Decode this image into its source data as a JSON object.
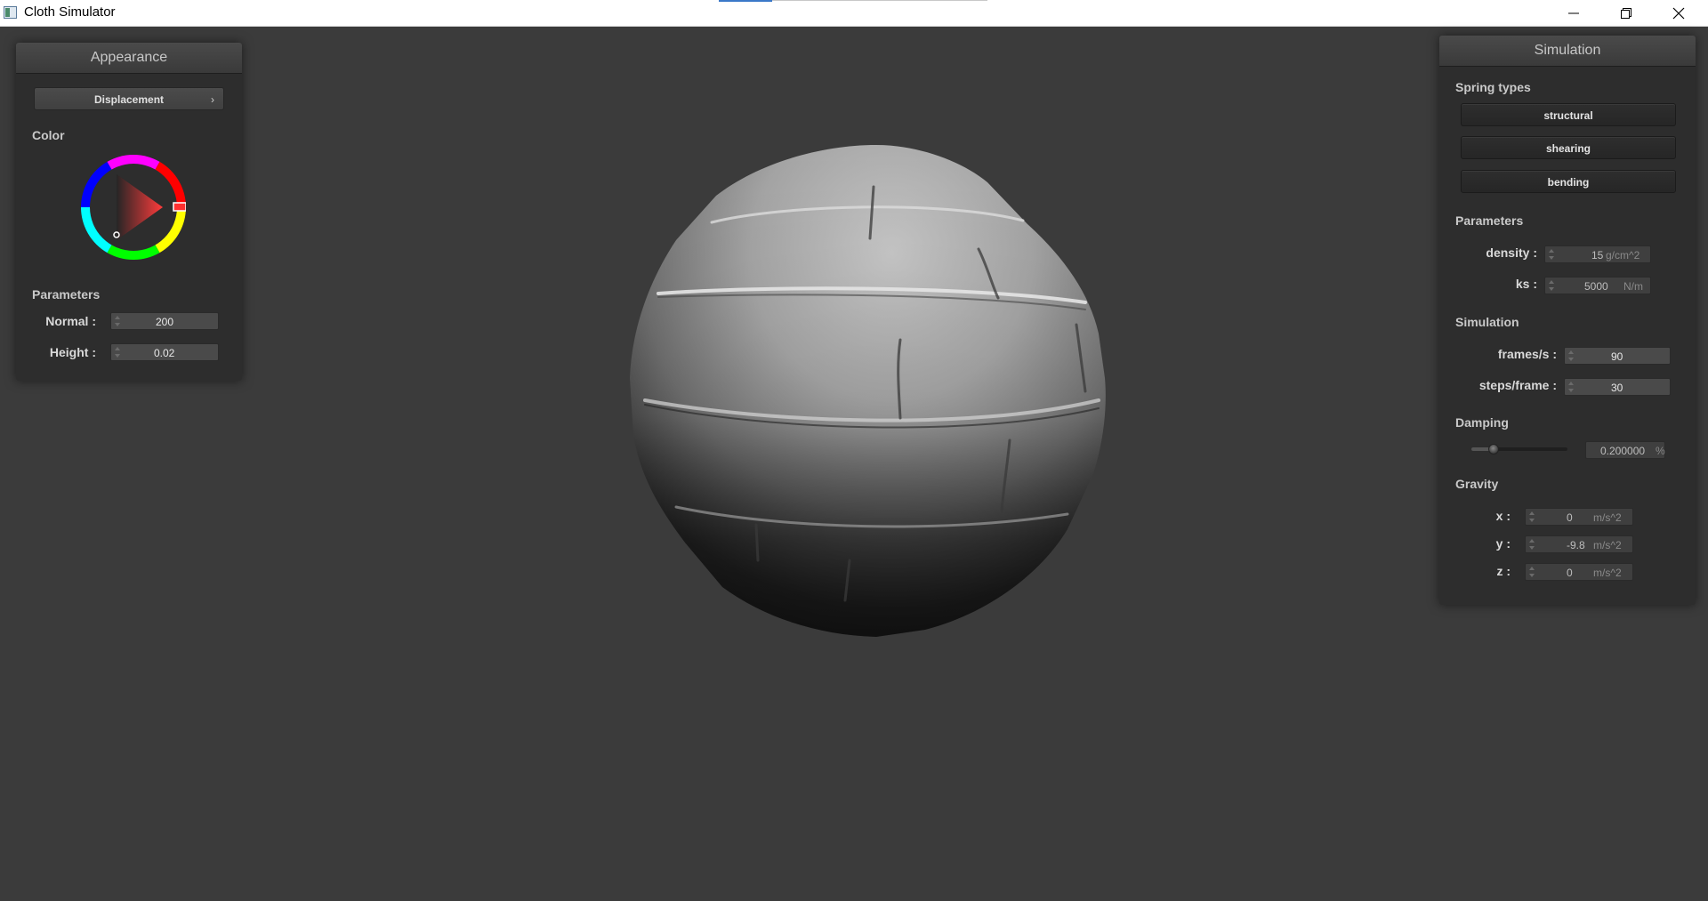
{
  "window": {
    "title": "Cloth Simulator",
    "controls": [
      "minimize-icon",
      "restore-icon",
      "close-icon"
    ]
  },
  "appearance": {
    "header": "Appearance",
    "shader_dropdown": {
      "selected": "Displacement",
      "chevron": "›"
    },
    "color_label": "Color",
    "color_value": "#ff0000",
    "parameters_label": "Parameters",
    "normal": {
      "label": "Normal :",
      "value": "200"
    },
    "height": {
      "label": "Height :",
      "value": "0.02"
    }
  },
  "simulation": {
    "header": "Simulation",
    "spring_types_label": "Spring types",
    "spring_buttons": [
      "structural",
      "shearing",
      "bending"
    ],
    "parameters_label": "Parameters",
    "density": {
      "label": "density :",
      "value": "15",
      "unit": "g/cm^2"
    },
    "ks": {
      "label": "ks :",
      "value": "5000",
      "unit": "N/m"
    },
    "simulation_label": "Simulation",
    "frames_per_s": {
      "label": "frames/s :",
      "value": "90"
    },
    "steps_per_frame": {
      "label": "steps/frame :",
      "value": "30"
    },
    "damping_label": "Damping",
    "damping": {
      "value": "0.200000",
      "unit": "%",
      "slider_fraction": 0.2
    },
    "gravity_label": "Gravity",
    "gravity": {
      "x": {
        "label": "x :",
        "value": "0",
        "unit": "m/s^2"
      },
      "y": {
        "label": "y :",
        "value": "-9.8",
        "unit": "m/s^2"
      },
      "z": {
        "label": "z :",
        "value": "0",
        "unit": "m/s^2"
      }
    }
  }
}
